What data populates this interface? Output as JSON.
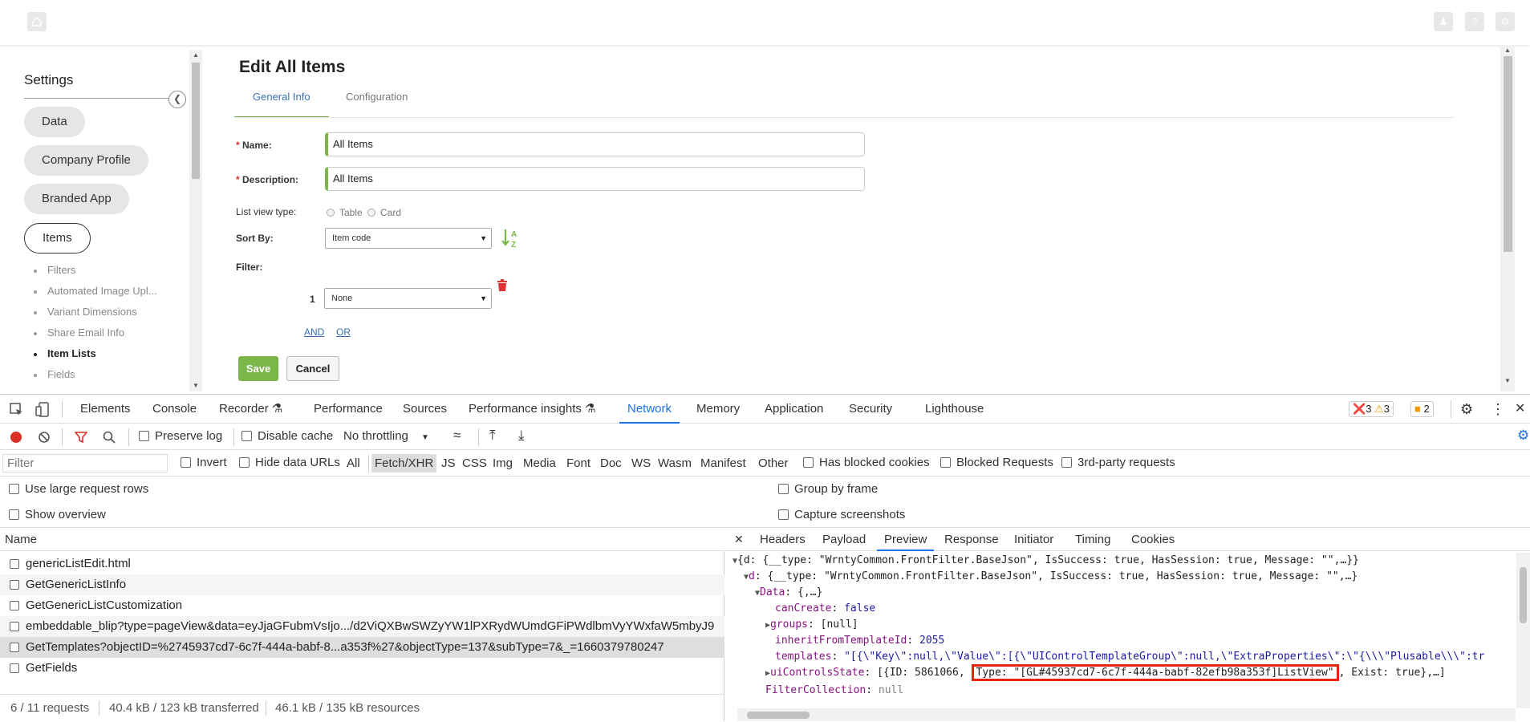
{
  "app": {
    "home_icon": "home-icon",
    "right_buttons": [
      "account-icon",
      "help-icon",
      "gear-icon"
    ]
  },
  "sidebar": {
    "title": "Settings",
    "pills": [
      "Data",
      "Company Profile",
      "Branded App",
      "Items"
    ],
    "sub_items": [
      "Filters",
      "Automated Image Upl...",
      "Variant Dimensions",
      "Share Email Info",
      "Item Lists",
      "Fields"
    ]
  },
  "form": {
    "title": "Edit All Items",
    "tabs": [
      "General Info",
      "Configuration"
    ],
    "name_label": "Name:",
    "name_value": "All Items",
    "description_label": "Description:",
    "description_value": "All Items",
    "list_view_label": "List view type:",
    "list_view_options": [
      "Table",
      "Card"
    ],
    "sort_by_label": "Sort By:",
    "sort_by_value": "Item code",
    "filter_label": "Filter:",
    "filter_index": "1",
    "filter_value": "None",
    "and_label": "AND",
    "or_label": "OR",
    "save_label": "Save",
    "cancel_label": "Cancel",
    "required_mark": "*"
  },
  "devtools": {
    "tabs": [
      "Elements",
      "Console",
      "Recorder",
      "Performance",
      "Sources",
      "Performance insights",
      "Network",
      "Memory",
      "Application",
      "Security",
      "Lighthouse"
    ],
    "active_tab": "Network",
    "errors": "3",
    "warnings": "3",
    "messages": "2",
    "toolbar": {
      "preserve_log": "Preserve log",
      "disable_cache": "Disable cache",
      "throttling": "No throttling"
    },
    "filter": {
      "placeholder": "Filter",
      "invert": "Invert",
      "hide_data_urls": "Hide data URLs",
      "types": [
        "All",
        "Fetch/XHR",
        "JS",
        "CSS",
        "Img",
        "Media",
        "Font",
        "Doc",
        "WS",
        "Wasm",
        "Manifest",
        "Other"
      ],
      "selected_type": "Fetch/XHR",
      "has_blocked_cookies": "Has blocked cookies",
      "blocked_requests": "Blocked Requests",
      "third_party": "3rd-party requests"
    },
    "options": {
      "large_rows": "Use large request rows",
      "show_overview": "Show overview",
      "group_by_frame": "Group by frame",
      "capture_screenshots": "Capture screenshots"
    },
    "requests": {
      "header": "Name",
      "rows": [
        "genericListEdit.html",
        "GetGenericListInfo",
        "GetGenericListCustomization",
        "embeddable_blip?type=pageView&data=eyJjaGFubmVsIjo.../d2ViQXBwSWZyYW1lPXRydWUmdGFiPWdlbmVyYWxfaW5mbyJ9",
        "GetTemplates?objectID=%2745937cd7-6c7f-444a-babf-8...a353f%27&objectType=137&subType=7&_=1660379780247",
        "GetFields"
      ]
    },
    "status": {
      "requests": "6 / 11 requests",
      "transferred": "40.4 kB / 123 kB transferred",
      "resources": "46.1 kB / 135 kB resources"
    },
    "preview_tabs": [
      "Headers",
      "Payload",
      "Preview",
      "Response",
      "Initiator",
      "Timing",
      "Cookies"
    ],
    "active_preview_tab": "Preview",
    "json_lines": {
      "l1": "{d: {__type: \"WrntyCommon.FrontFilter.BaseJson\", IsSuccess: true, HasSession: true, Message: \"\",…}}",
      "l2_key": "d",
      "l2_val": "{__type: \"WrntyCommon.FrontFilter.BaseJson\", IsSuccess: true, HasSession: true, Message: \"\",…}",
      "l3_key": "Data",
      "l3_val": "{,…}",
      "l4_key": "canCreate",
      "l4_val": "false",
      "l5_key": "groups",
      "l5_val": "[null]",
      "l6_key": "inheritFromTemplateId",
      "l6_val": "2055",
      "l7_key": "templates",
      "l7_val": "\"[{\\\"Key\\\":null,\\\"Value\\\":[{\\\"UIControlTemplateGroup\\\":null,\\\"ExtraProperties\\\":\\\"{\\\\\\\"Plusable\\\\\\\":tr",
      "l8_key": "uiControlsState",
      "l8_pre": "[{ID: 5861066, ",
      "l8_hl": "Type: \"[GL#45937cd7-6c7f-444a-babf-82efb98a353f]ListView\"",
      "l8_post": ", Exist: true},…]",
      "l9_key": "FilterCollection",
      "l9_val": "null"
    }
  }
}
